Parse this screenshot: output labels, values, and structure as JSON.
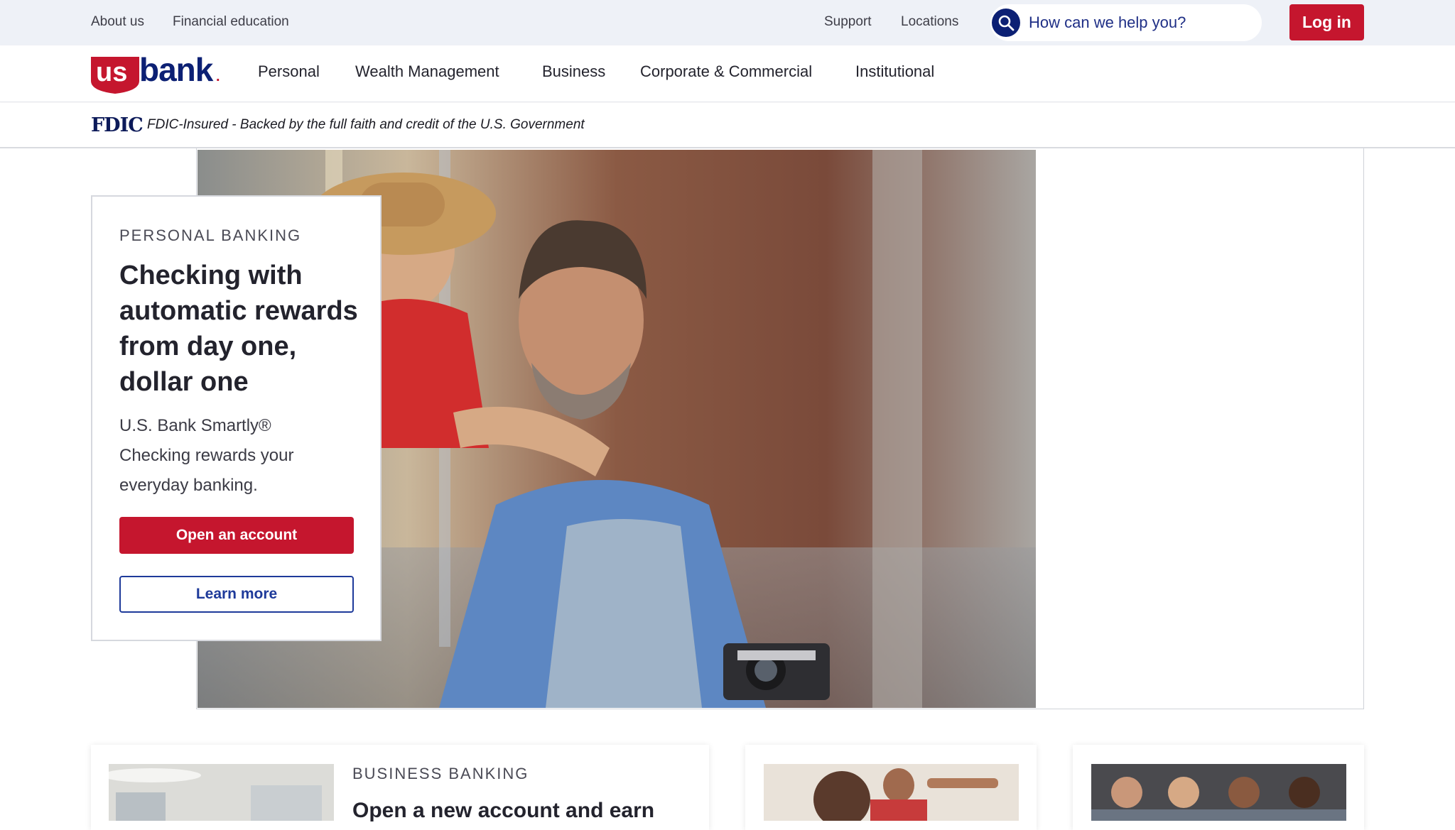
{
  "utility": {
    "links": [
      "About us",
      "Financial education"
    ],
    "right_links": [
      "Support",
      "Locations"
    ],
    "search_placeholder": "How can we help you?",
    "login_label": "Log in"
  },
  "brand": {
    "logo_text_us": "us",
    "logo_text_bank": "bank",
    "logo_mark": ".",
    "red": "#c5162e",
    "navy": "#0c2074"
  },
  "nav": {
    "items": [
      "Personal",
      "Wealth Management",
      "Business",
      "Corporate & Commercial",
      "Institutional"
    ]
  },
  "fdic": {
    "logo": "FDIC",
    "text": "FDIC-Insured - Backed by the full faith and credit of the U.S. Government"
  },
  "hero": {
    "eyebrow": "PERSONAL BANKING",
    "title": "Checking with automatic rewards from day one, dollar one",
    "description": "U.S. Bank Smartly® Checking rewards your everyday banking.",
    "primary_button": "Open an account",
    "secondary_button": "Learn more"
  },
  "cards": [
    {
      "eyebrow": "BUSINESS BANKING",
      "title": "Open a new account and earn"
    },
    {
      "eyebrow": "",
      "title": ""
    },
    {
      "eyebrow": "",
      "title": ""
    }
  ]
}
